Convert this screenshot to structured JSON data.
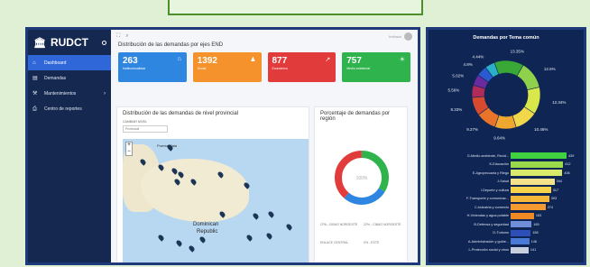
{
  "app": {
    "title": "RUDCT"
  },
  "sidebar": {
    "items": [
      {
        "label": "Dashboard",
        "icon": "home-icon",
        "active": true
      },
      {
        "label": "Demandas",
        "icon": "book-icon"
      },
      {
        "label": "Mantenimientos",
        "icon": "wrench-icon",
        "has_submenu": true
      },
      {
        "label": "Centro de reportes",
        "icon": "printer-icon"
      }
    ]
  },
  "header": {
    "user": "Invitado"
  },
  "main": {
    "section_title": "Distribución de las demandas por ejes END",
    "cards": [
      {
        "value": "263",
        "label": "Institucionalidad",
        "color": "#2e86e0",
        "icon": "bank-icon"
      },
      {
        "value": "1392",
        "label": "Social",
        "color": "#f5922b",
        "icon": "users-icon"
      },
      {
        "value": "877",
        "label": "Económico",
        "color": "#e23b3b",
        "icon": "trend-icon"
      },
      {
        "value": "757",
        "label": "Medio ambiental",
        "color": "#2fb34d",
        "icon": "sun-icon"
      }
    ],
    "map_panel": {
      "title": "Distribución de las demandas de nivel provincial",
      "filter_label": "CAMBIAR NIVEL",
      "filter_value": "Provincial",
      "places": [
        "Dominican",
        "Republic",
        "Puerto Plata"
      ]
    },
    "pct_panel": {
      "title": "Porcentaje de demandas por región",
      "center": "100%",
      "legend": [
        "CPA - CIBAO NOROESTE",
        "22% - CIBAO NOROESTE",
        "ENLACE CENTRAL",
        "0% - ESTE"
      ]
    }
  },
  "right": {
    "title": "Demandas por Tema común",
    "chart_data": [
      {
        "type": "pie",
        "labels": [
          "13.35%",
          "12.5%",
          "12.34%",
          "10.46%",
          "9.64%",
          "9.27%",
          "8.33%",
          "5.56%",
          "5.02%",
          "4.8%",
          "4.44%"
        ],
        "values": [
          13.35,
          12.5,
          12.34,
          10.46,
          9.64,
          9.27,
          8.33,
          5.56,
          5.02,
          4.8,
          4.44
        ],
        "colors": [
          "#3aa836",
          "#8fd14a",
          "#d8e84a",
          "#f0d84a",
          "#f0a730",
          "#e8742a",
          "#d84a30",
          "#b02a5a",
          "#6a2aa0",
          "#2a5ad0",
          "#2ab0c8"
        ]
      },
      {
        "type": "bar",
        "categories": [
          "G-Medio ambiente, Recid...",
          "K-Educación",
          "E-Agropecuaria y Riego",
          "J-Salud",
          "I-Deporte y cultura",
          "F-Transporte y comunicac...",
          "C-Industria y comercio",
          "H-Viviendas y agua potable",
          "B-Defensa y seguridad",
          "D-Turismo",
          "A-Administración y gobie...",
          "L-Protección social y otros"
        ],
        "values": [
          439,
          412,
          406,
          344,
          317,
          303,
          274,
          183,
          165,
          158,
          146,
          141
        ],
        "colors": [
          "#3fd13f",
          "#9ad94a",
          "#d7e86a",
          "#f3e28a",
          "#f6d34a",
          "#f5b73a",
          "#f59a30",
          "#f08a24",
          "#6f8fd8",
          "#2f4fb8",
          "#4a7ad8",
          "#c8d0e0"
        ]
      }
    ]
  }
}
